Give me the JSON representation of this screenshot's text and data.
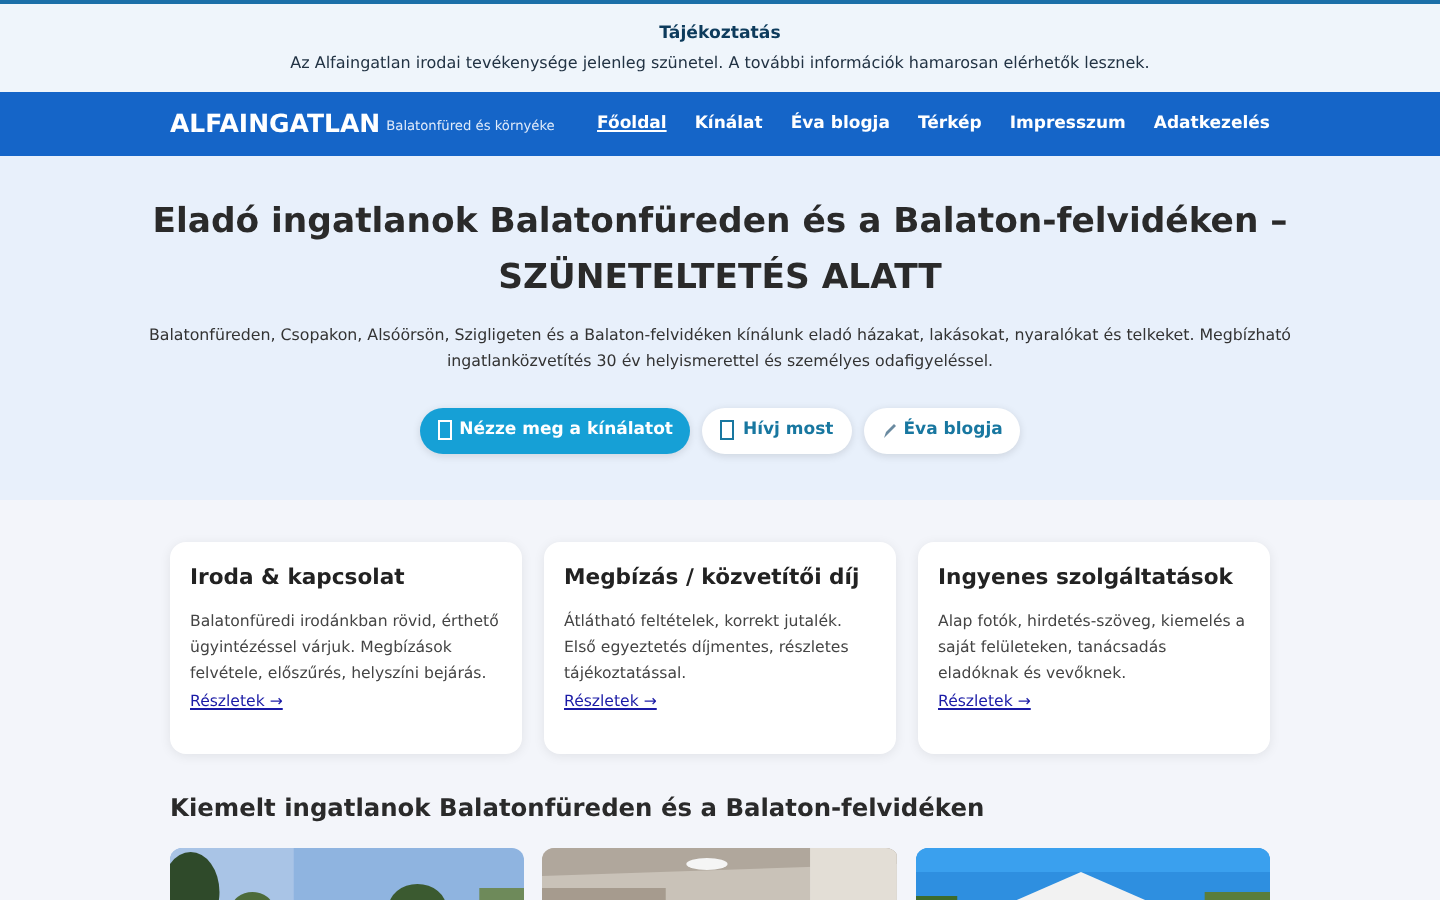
{
  "notice": {
    "title": "Tájékoztatás",
    "text": "Az Alfaingatlan irodai tevékenysége jelenleg szünetel. A további információk hamarosan elérhetők lesznek."
  },
  "navbar": {
    "brand": "ALFAINGATLAN",
    "tagline": "Balatonfüred és környéke",
    "links": [
      {
        "label": "Főoldal",
        "selected": true
      },
      {
        "label": "Kínálat",
        "selected": false
      },
      {
        "label": "Éva blogja",
        "selected": false
      },
      {
        "label": "Térkép",
        "selected": false
      },
      {
        "label": "Impresszum",
        "selected": false
      },
      {
        "label": "Adatkezelés",
        "selected": false
      }
    ]
  },
  "hero": {
    "title": "Eladó ingatlanok Balatonfüreden és a Balaton-felvidéken – SZÜNETELTETÉS ALATT",
    "text": "Balatonfüreden, Csopakon, Alsóörsön, Szigligeten és a Balaton-felvidéken kínálunk eladó házakat, lakásokat, nyaralókat és telkeket. Megbízható ingatlanközvetítés 30 év helyismerettel és személyes odafigyeléssel.",
    "buttons": [
      {
        "label": "Nézze meg a kínálatot",
        "kind": "primary"
      },
      {
        "label": "Hívj most",
        "kind": "light"
      },
      {
        "label": "Éva blogja",
        "kind": "light"
      }
    ]
  },
  "cards": [
    {
      "title": "Iroda & kapcsolat",
      "text": "Balatonfüredi irodánkban rövid, érthető ügyintézéssel várjuk. Megbízások felvétele, előszűrés, helyszíni bejárás.",
      "link": "Részletek →"
    },
    {
      "title": "Megbízás / közvetítői díj",
      "text": "Átlátható feltételek, korrekt jutalék. Első egyeztetés díjmentes, részletes tájékoztatással.",
      "link": "Részletek →"
    },
    {
      "title": "Ingyenes szolgáltatások",
      "text": "Alap fotók, hirdetés-szöveg, kiemelés a saját felületeken, tanácsadás eladóknak és vevőknek.",
      "link": "Részletek →"
    }
  ],
  "featured": {
    "title": "Kiemelt ingatlanok Balatonfüreden és a Balaton-felvidéken"
  }
}
